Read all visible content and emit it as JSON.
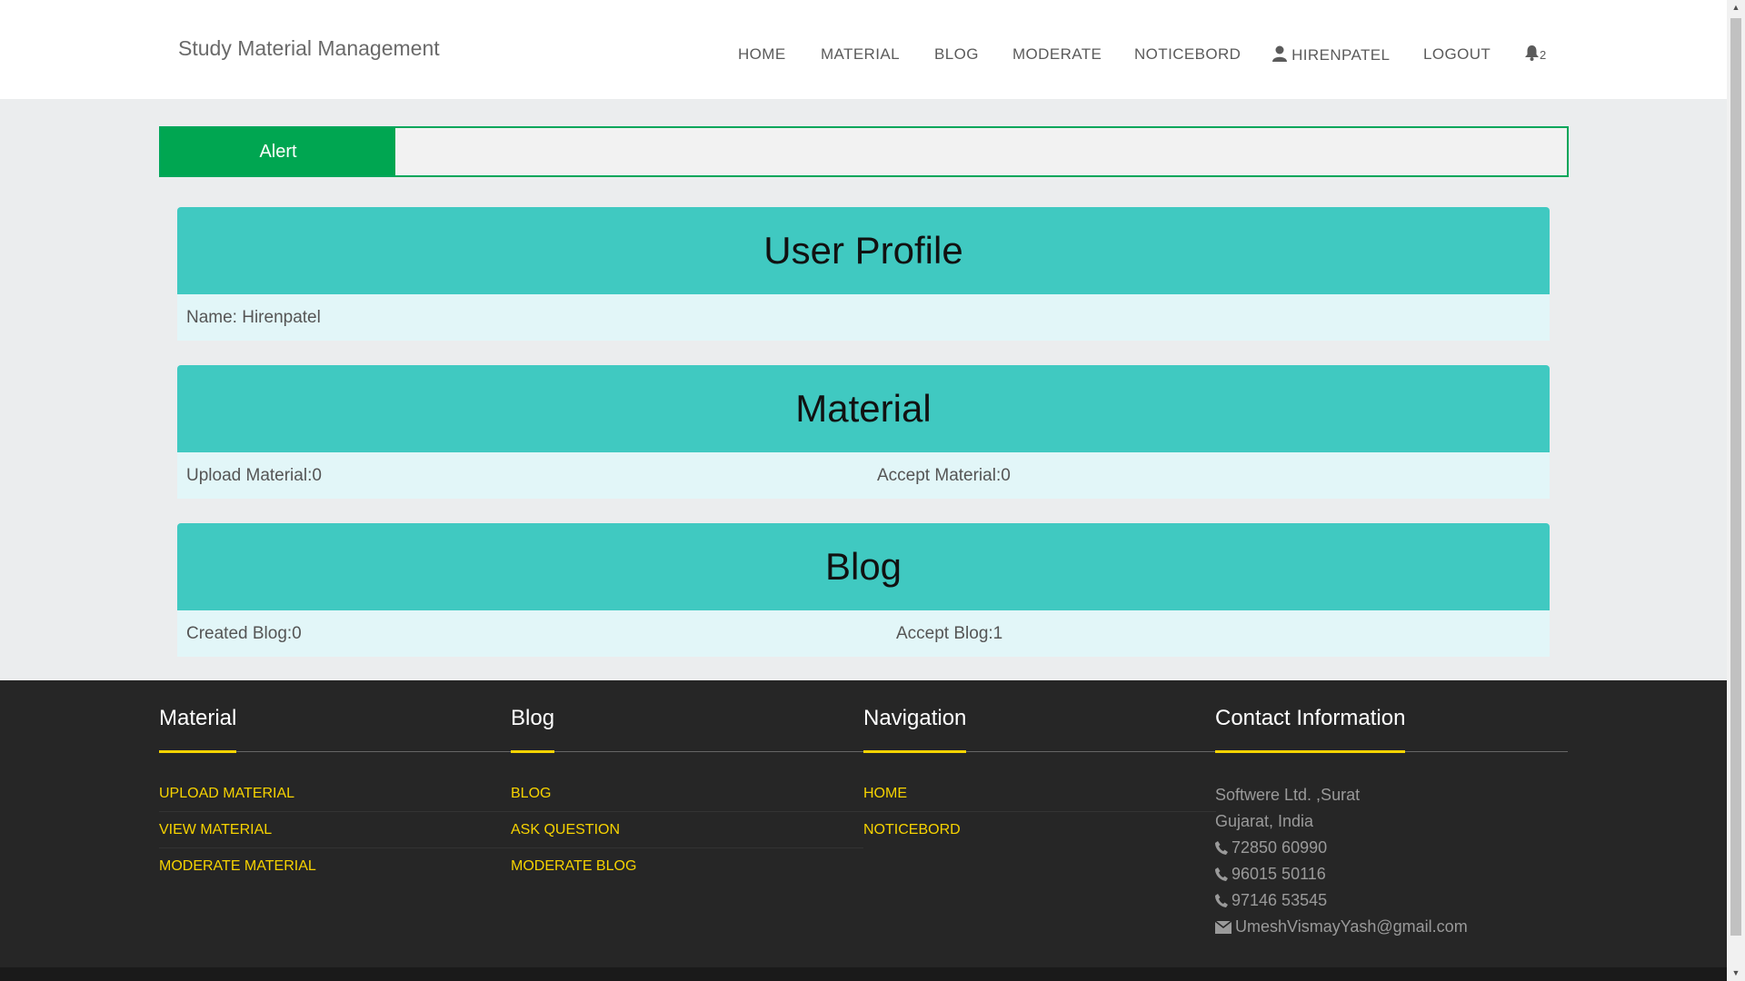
{
  "brand": "Study Material Management",
  "nav": {
    "home": "HOME",
    "material": "MATERIAL",
    "blog": "BLOG",
    "moderate": "MODERATE",
    "noticebord": "NOTICEBORD",
    "user": "HIRENPATEL",
    "logout": "LOGOUT",
    "notifications": "2"
  },
  "alert": {
    "label": "Alert"
  },
  "profile": {
    "title": "User Profile",
    "name": "Name: Hirenpatel"
  },
  "material": {
    "title": "Material",
    "upload": "Upload Material:0",
    "accept": "Accept Material:0"
  },
  "blog": {
    "title": "Blog",
    "created": "Created Blog:0",
    "accept": "Accept Blog:1"
  },
  "footer": {
    "material": {
      "title": "Material",
      "links": [
        "UPLOAD MATERIAL",
        "VIEW MATERIAL",
        "MODERATE MATERIAL"
      ]
    },
    "blog": {
      "title": "Blog",
      "links": [
        "BLOG",
        "ASK QUESTION",
        "MODERATE BLOG"
      ]
    },
    "navigation": {
      "title": "Navigation",
      "links": [
        "HOME",
        "NOTICEBORD"
      ]
    },
    "contact": {
      "title": "Contact Information",
      "address1": "Softwere Ltd. ,Surat",
      "address2": "Gujarat, India",
      "phone1": "72850 60990",
      "phone2": "96015 50116",
      "phone3": "97146 53545",
      "email": "UmeshVismayYash@gmail.com"
    }
  },
  "colors": {
    "accent": "#40c9c1",
    "alert": "#00a651",
    "footer_link": "#f7d300",
    "footer_bg": "#262626"
  }
}
